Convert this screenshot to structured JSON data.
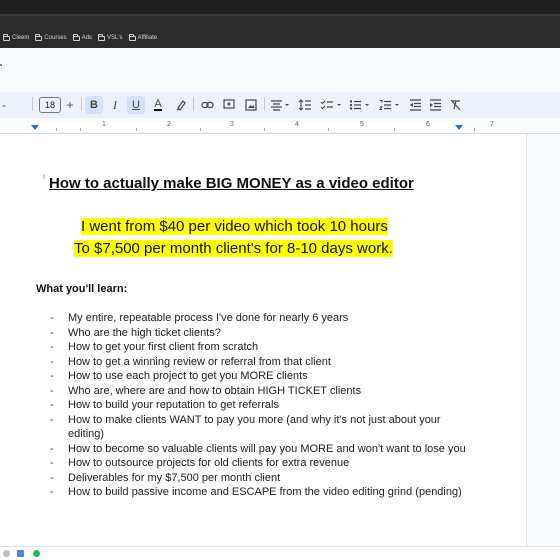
{
  "bookmarks": [
    "Cleem",
    "Courses",
    "Ads",
    "VSL's",
    "Affiliate"
  ],
  "toolbar": {
    "font_size": "18",
    "decrease_label": "-",
    "increase_label": "+",
    "bold_label": "B",
    "italic_label": "I",
    "underline_label": "U",
    "text_color_label": "A"
  },
  "ruler": {
    "numbers": [
      "1",
      "2",
      "3",
      "4",
      "5",
      "6",
      "7"
    ]
  },
  "document": {
    "title": "How to actually make BIG MONEY as a video editor",
    "highlight_line1": "I went from $40 per video which took 10 hours",
    "highlight_line2": "To $7,500 per month client's for 8-10 days work.",
    "learn_heading": "What you'll learn:",
    "items": [
      "My entire, repeatable process I've done for nearly 6 years",
      "Who are the high ticket clients?",
      "How to get your first client from scratch",
      "How to get a winning review or referral from that client",
      "How to use each project to get you MORE clients",
      "Who are, where are and how to obtain HIGH TICKET clients",
      "How to build your reputation to get referrals",
      "How to make clients WANT to pay you more (and why it's not just about your editing)",
      "How to become so valuable clients will pay you MORE and won't want to lose you",
      "How to outsource projects for old clients for extra revenue",
      "Deliverables for my $7,500 per month client",
      "How to build passive income and ESCAPE from the video editing grind (pending)"
    ]
  },
  "colors": {
    "highlight": "#ffff00",
    "toolbar_bg": "#edf2fa",
    "active_button": "#d3e3fd",
    "ruler_marker": "#1a73e8"
  }
}
